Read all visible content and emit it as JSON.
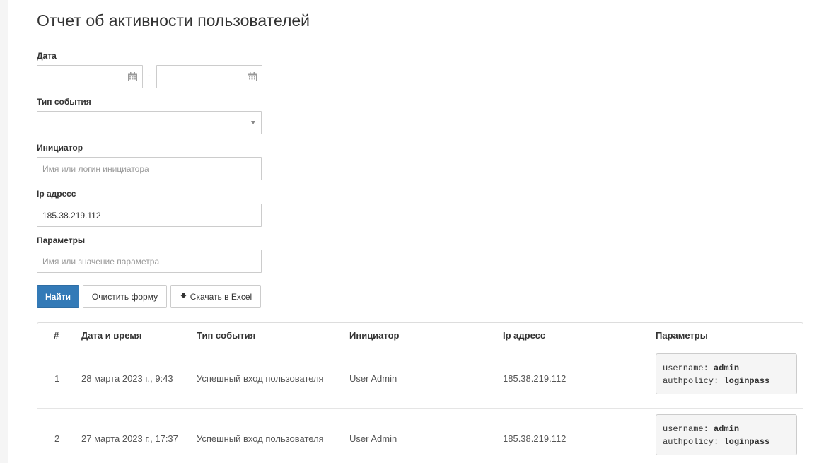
{
  "title": "Отчет об активности пользователей",
  "form": {
    "date_label": "Дата",
    "date_separator": "-",
    "event_type_label": "Тип события",
    "initiator_label": "Инициатор",
    "initiator_placeholder": "Имя или логин инициатора",
    "ip_label": "Ip адресс",
    "ip_value": "185.38.219.112",
    "params_label": "Параметры",
    "params_placeholder": "Имя или значение параметра"
  },
  "buttons": {
    "find": "Найти",
    "clear": "Очистить форму",
    "excel": "Скачать в Excel"
  },
  "table": {
    "headers": [
      "#",
      "Дата и время",
      "Тип события",
      "Инициатор",
      "Ip адресс",
      "Параметры"
    ],
    "rows": [
      {
        "num": "1",
        "datetime": "28 марта 2023 г., 9:43",
        "event": "Успешный вход пользователя",
        "initiator": "User Admin",
        "ip": "185.38.219.112",
        "p1_key": "username:",
        "p1_val": "admin",
        "p2_key": "authpolicy:",
        "p2_val": "loginpass"
      },
      {
        "num": "2",
        "datetime": "27 марта 2023 г., 17:37",
        "event": "Успешный вход пользователя",
        "initiator": "User Admin",
        "ip": "185.38.219.112",
        "p1_key": "username:",
        "p1_val": "admin",
        "p2_key": "authpolicy:",
        "p2_val": "loginpass"
      }
    ]
  },
  "icons": {
    "calendar": "calendar-icon",
    "download": "download-icon",
    "caret": "chevron-down-icon"
  },
  "colors": {
    "primary": "#337ab7"
  }
}
